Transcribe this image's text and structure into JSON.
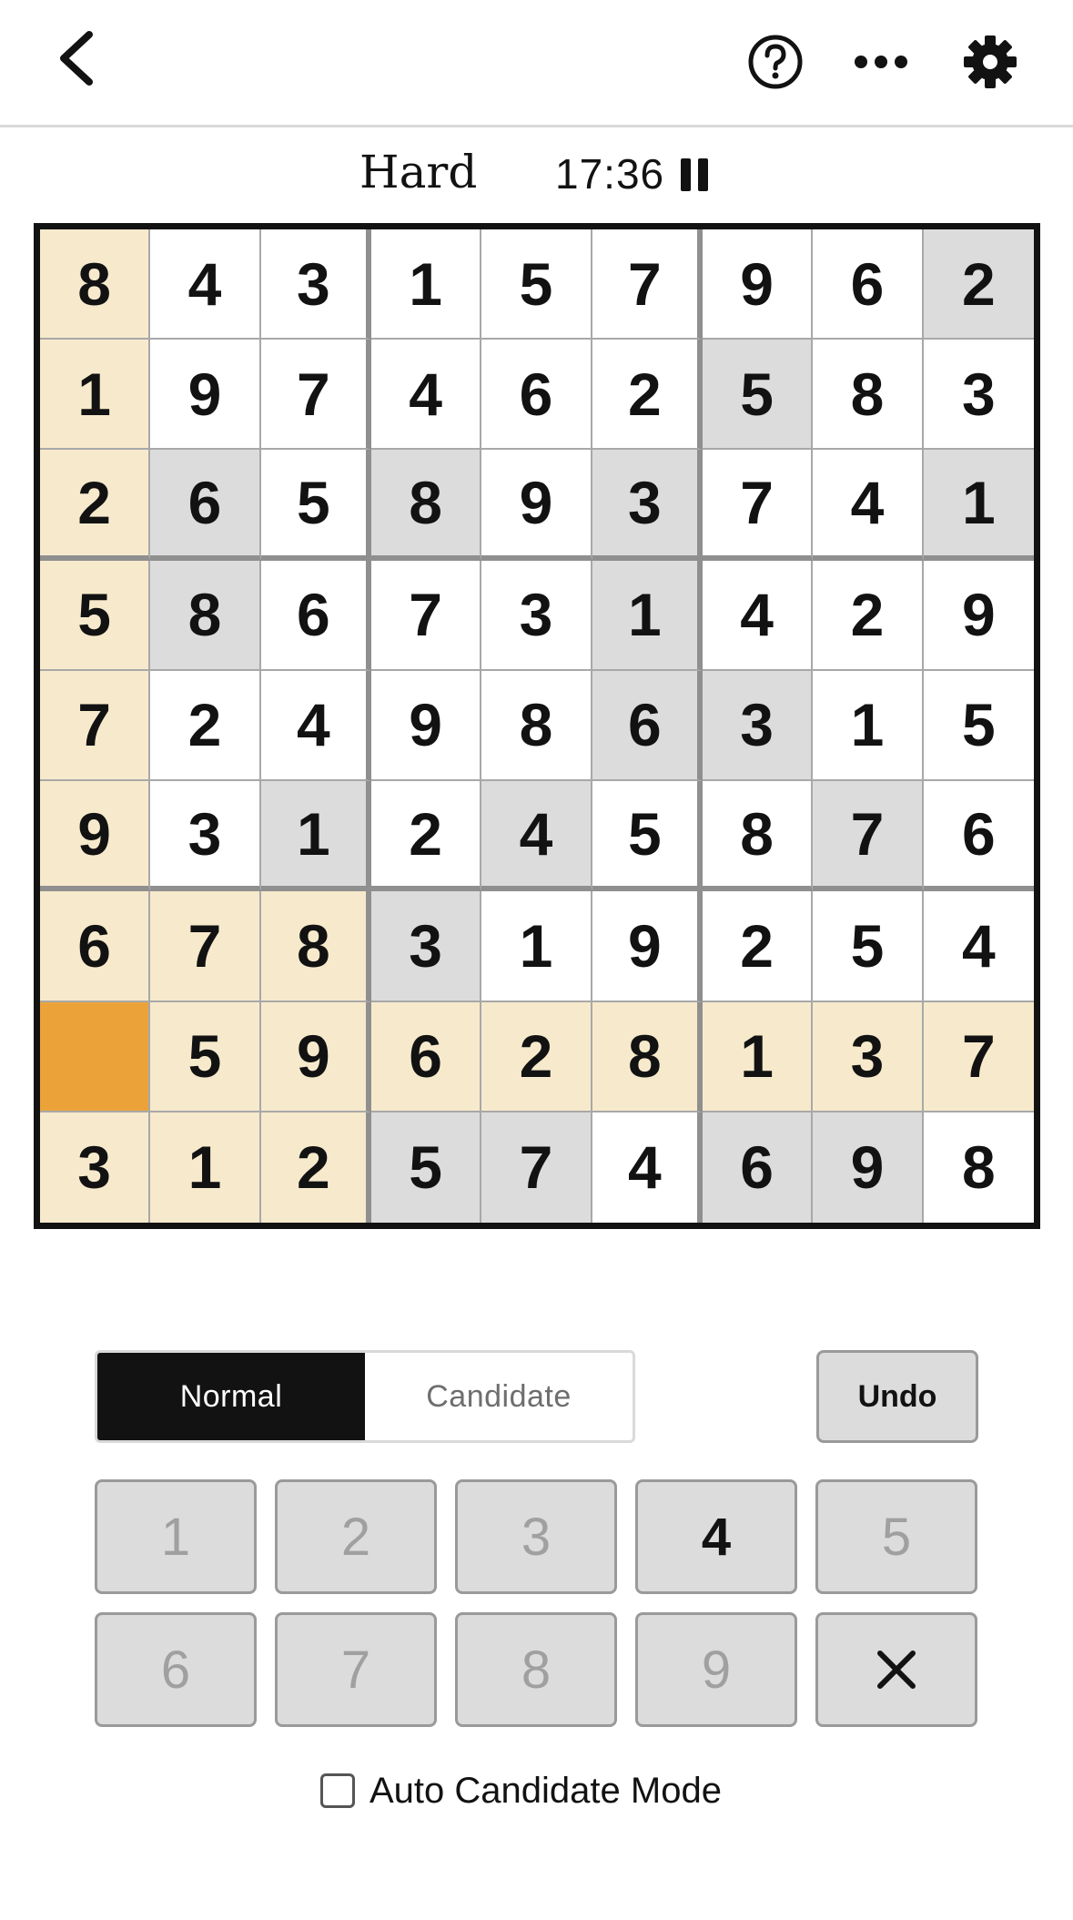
{
  "header": {
    "back_icon": "chevron-left-icon",
    "help_icon": "question-circle-icon",
    "more_icon": "ellipsis-icon",
    "settings_icon": "gear-icon"
  },
  "status": {
    "difficulty": "Hard",
    "timer": "17:36",
    "pause_icon": "pause-icon"
  },
  "board": {
    "rows": [
      [
        "8",
        "4",
        "3",
        "1",
        "5",
        "7",
        "9",
        "6",
        "2"
      ],
      [
        "1",
        "9",
        "7",
        "4",
        "6",
        "2",
        "5",
        "8",
        "3"
      ],
      [
        "2",
        "6",
        "5",
        "8",
        "9",
        "3",
        "7",
        "4",
        "1"
      ],
      [
        "5",
        "8",
        "6",
        "7",
        "3",
        "1",
        "4",
        "2",
        "9"
      ],
      [
        "7",
        "2",
        "4",
        "9",
        "8",
        "6",
        "3",
        "1",
        "5"
      ],
      [
        "9",
        "3",
        "1",
        "2",
        "4",
        "5",
        "8",
        "7",
        "6"
      ],
      [
        "6",
        "7",
        "8",
        "3",
        "1",
        "9",
        "2",
        "5",
        "4"
      ],
      [
        "",
        "5",
        "9",
        "6",
        "2",
        "8",
        "1",
        "3",
        "7"
      ],
      [
        "3",
        "1",
        "2",
        "5",
        "7",
        "4",
        "6",
        "9",
        "8"
      ]
    ],
    "selected_cell": [
      7,
      0
    ],
    "highlighted_value": "",
    "colors": {
      "selected": "#eba339",
      "peer": "#f7eacc",
      "same_number": "#dcdcdc",
      "cell": "#ffffff"
    }
  },
  "modes": {
    "normal_label": "Normal",
    "candidate_label": "Candidate",
    "active": "normal"
  },
  "undo_label": "Undo",
  "keypad": {
    "keys": [
      {
        "label": "1",
        "enabled": false
      },
      {
        "label": "2",
        "enabled": false
      },
      {
        "label": "3",
        "enabled": false
      },
      {
        "label": "4",
        "enabled": true
      },
      {
        "label": "5",
        "enabled": false
      },
      {
        "label": "6",
        "enabled": false
      },
      {
        "label": "7",
        "enabled": false
      },
      {
        "label": "8",
        "enabled": false
      },
      {
        "label": "9",
        "enabled": false
      }
    ],
    "delete_icon": "close-icon"
  },
  "auto_candidate": {
    "label": "Auto Candidate Mode",
    "checked": false
  }
}
